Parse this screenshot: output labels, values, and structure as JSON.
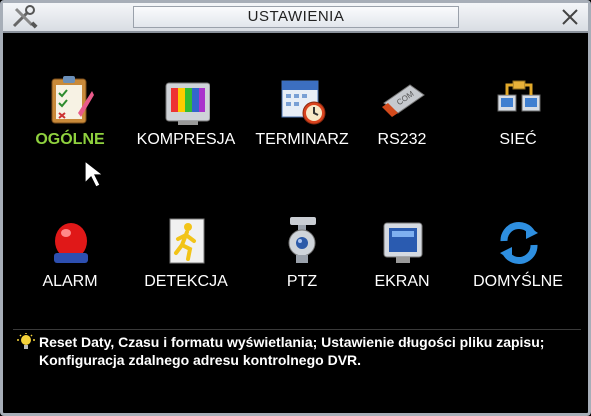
{
  "window": {
    "title": "USTAWIENIA"
  },
  "icons": [
    {
      "label": "OGÓLNE",
      "icon": "general-settings-icon",
      "selected": true
    },
    {
      "label": "KOMPRESJA",
      "icon": "compression-tv-icon"
    },
    {
      "label": "TERMINARZ",
      "icon": "schedule-calendar-icon"
    },
    {
      "label": "RS232",
      "icon": "rs232-connector-icon"
    },
    {
      "label": "SIEĆ",
      "icon": "network-icon"
    },
    {
      "label": "ALARM",
      "icon": "alarm-light-icon"
    },
    {
      "label": "DETEKCJA",
      "icon": "detection-runner-icon"
    },
    {
      "label": "PTZ",
      "icon": "ptz-camera-icon"
    },
    {
      "label": "EKRAN",
      "icon": "display-monitor-icon"
    },
    {
      "label": "DOMYŚLNE",
      "icon": "default-reset-icon"
    }
  ],
  "hint": {
    "text": "Reset Daty, Czasu i formatu wyświetlania; Ustawienie długości pliku zapisu; Konfiguracja zdalnego adresu kontrolnego DVR.",
    "icon": "lightbulb-icon"
  },
  "colors": {
    "selected_label": "#8fd13e",
    "background": "#000000"
  }
}
